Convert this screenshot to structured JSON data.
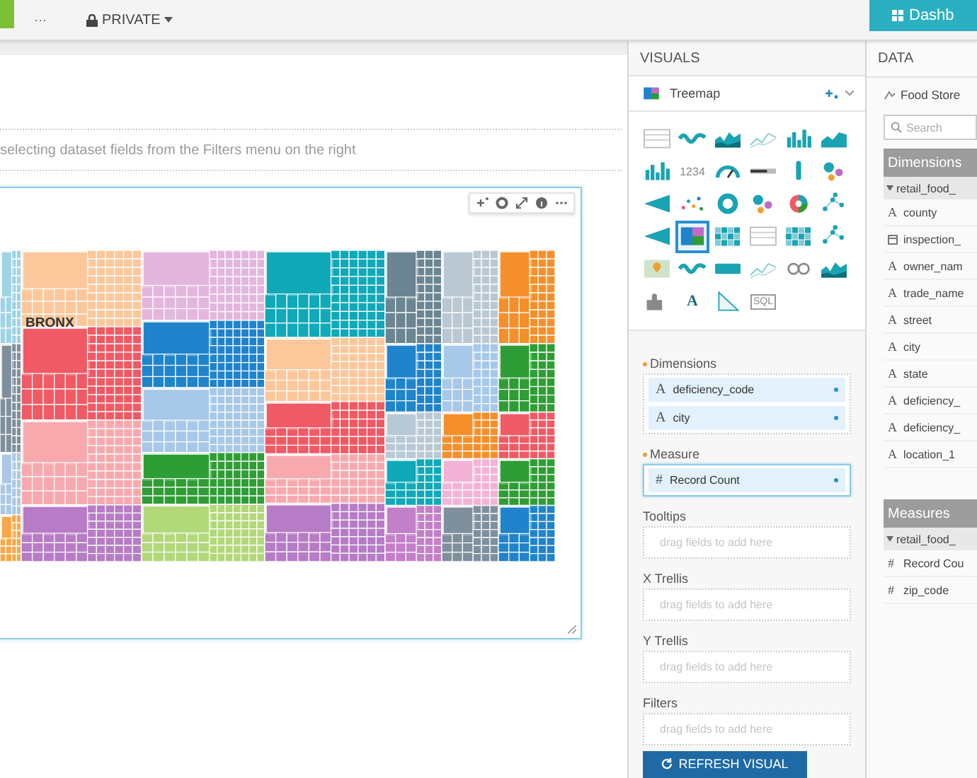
{
  "topbar": {
    "more": "···",
    "privacy": "PRIVATE",
    "dashboard_button": "Dashb"
  },
  "canvas": {
    "hint": "selecting dataset fields from the Filters menu on the right",
    "treemap_label": "BRONX"
  },
  "visuals": {
    "title": "VISUALS",
    "current_type": "Treemap",
    "gallery": [
      {
        "kind": "table",
        "selected": false
      },
      {
        "kind": "wave",
        "selected": false
      },
      {
        "kind": "stacked",
        "selected": false
      },
      {
        "kind": "lines",
        "selected": false
      },
      {
        "kind": "bars",
        "selected": false
      },
      {
        "kind": "area",
        "selected": false
      },
      {
        "kind": "bars",
        "selected": false
      },
      {
        "kind": "number",
        "text": "1234",
        "selected": false
      },
      {
        "kind": "gauge",
        "selected": false
      },
      {
        "kind": "bullet",
        "selected": false
      },
      {
        "kind": "marker",
        "selected": false
      },
      {
        "kind": "bubbles",
        "selected": false
      },
      {
        "kind": "funnel",
        "selected": false
      },
      {
        "kind": "scatter",
        "selected": false
      },
      {
        "kind": "donut",
        "selected": false
      },
      {
        "kind": "bubbles",
        "selected": false
      },
      {
        "kind": "pie",
        "selected": false
      },
      {
        "kind": "network",
        "selected": false
      },
      {
        "kind": "funnel",
        "selected": false
      },
      {
        "kind": "treemap",
        "selected": true
      },
      {
        "kind": "heatmap",
        "selected": false
      },
      {
        "kind": "table",
        "selected": false
      },
      {
        "kind": "heatmap",
        "selected": false
      },
      {
        "kind": "network",
        "selected": false
      },
      {
        "kind": "map",
        "selected": false
      },
      {
        "kind": "wave",
        "selected": false
      },
      {
        "kind": "tag",
        "selected": false
      },
      {
        "kind": "lines",
        "selected": false
      },
      {
        "kind": "chain",
        "selected": false
      },
      {
        "kind": "stacked",
        "selected": false
      },
      {
        "kind": "puzzle",
        "selected": false
      },
      {
        "kind": "letter",
        "text": "A",
        "selected": false
      },
      {
        "kind": "corner",
        "selected": false
      },
      {
        "kind": "sql",
        "text": "SQL",
        "selected": false
      }
    ],
    "shelves": [
      {
        "label": "Dimensions",
        "required": true,
        "highlighted": false,
        "fields": [
          {
            "type": "A",
            "name": "deficiency_code"
          },
          {
            "type": "A",
            "name": "city"
          }
        ]
      },
      {
        "label": "Measure",
        "required": true,
        "highlighted": true,
        "fields": [
          {
            "type": "#",
            "name": "Record Count"
          }
        ]
      },
      {
        "label": "Tooltips",
        "required": false,
        "highlighted": false,
        "placeholder": "drag fields to add here"
      },
      {
        "label": "X Trellis",
        "required": false,
        "highlighted": false,
        "placeholder": "drag fields to add here"
      },
      {
        "label": "Y Trellis",
        "required": false,
        "highlighted": false,
        "placeholder": "drag fields to add here"
      },
      {
        "label": "Filters",
        "required": false,
        "highlighted": false,
        "placeholder": "drag fields to add here"
      }
    ],
    "refresh_button": "REFRESH VISUAL"
  },
  "data": {
    "title": "DATA",
    "dataset": "Food Store",
    "search": {
      "placeholder": "Search"
    },
    "sections": [
      {
        "title": "Dimensions",
        "group": "retail_food_",
        "fields": [
          {
            "kind": "text",
            "type": "A",
            "name": "county"
          },
          {
            "kind": "date",
            "name": "inspection_"
          },
          {
            "kind": "text",
            "type": "A",
            "name": "owner_nam"
          },
          {
            "kind": "text",
            "type": "A",
            "name": "trade_name"
          },
          {
            "kind": "text",
            "type": "A",
            "name": "street"
          },
          {
            "kind": "text",
            "type": "A",
            "name": "city"
          },
          {
            "kind": "text",
            "type": "A",
            "name": "state"
          },
          {
            "kind": "text",
            "type": "A",
            "name": "deficiency_"
          },
          {
            "kind": "text",
            "type": "A",
            "name": "deficiency_"
          },
          {
            "kind": "text",
            "type": "A",
            "name": "location_1"
          }
        ]
      },
      {
        "title": "Measures",
        "group": "retail_food_",
        "fields": [
          {
            "kind": "text",
            "type": "#",
            "name": "Record Cou"
          },
          {
            "kind": "text",
            "type": "#",
            "name": "zip_code"
          }
        ]
      }
    ]
  }
}
